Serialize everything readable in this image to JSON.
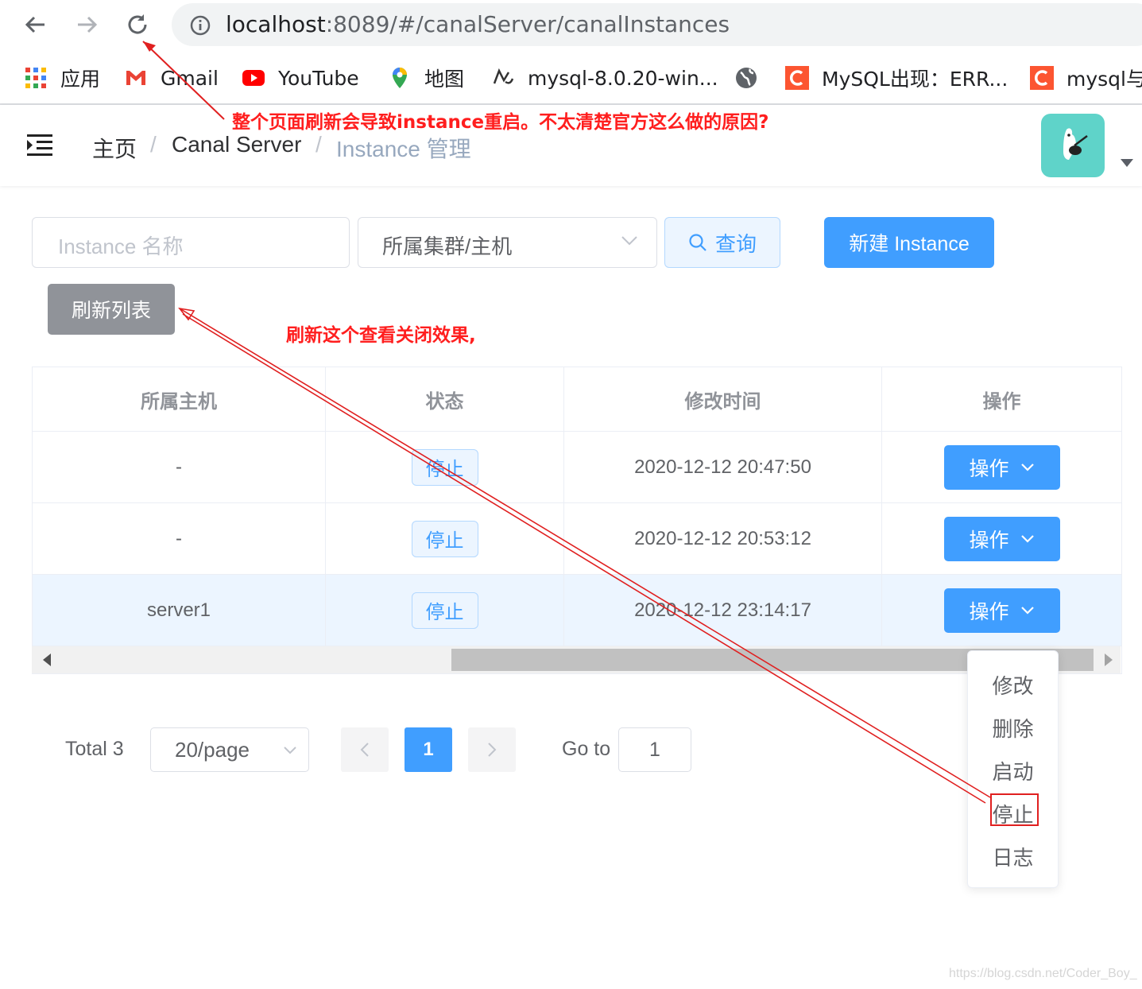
{
  "browser": {
    "url_host": "localhost",
    "url_rest": ":8089/#/canalServer/canalInstances",
    "bookmarks": [
      {
        "label": "应用",
        "icon": "apps-grid-icon"
      },
      {
        "label": "Gmail",
        "icon": "gmail-icon"
      },
      {
        "label": "YouTube",
        "icon": "youtube-icon"
      },
      {
        "label": "地图",
        "icon": "maps-pin-icon"
      },
      {
        "label": "mysql-8.0.20-win...",
        "icon": "bookmark-site-icon"
      },
      {
        "label": "",
        "icon": "globe-icon"
      },
      {
        "label": "MySQL出现：ERR...",
        "icon": "csdn-c-icon"
      },
      {
        "label": "mysql与",
        "icon": "csdn-c-icon"
      }
    ]
  },
  "breadcrumb": {
    "home": "主页",
    "sep1": "/",
    "section": "Canal Server",
    "sep2": "/",
    "current": "Instance 管理"
  },
  "filters": {
    "name_placeholder": "Instance 名称",
    "cluster_select": "所属集群/主机",
    "query_label": "查询",
    "new_label": "新建 Instance",
    "refresh_label": "刷新列表"
  },
  "annotations": {
    "top_note": "整个页面刷新会导致instance重启。不太清楚官方这么做的原因?",
    "refresh_note": "刷新这个查看关闭效果,"
  },
  "table": {
    "columns": [
      "所属主机",
      "状态",
      "修改时间",
      "操作"
    ],
    "rows": [
      {
        "host": "-",
        "status": "停止",
        "modified": "2020-12-12 20:47:50",
        "action": "操作"
      },
      {
        "host": "-",
        "status": "停止",
        "modified": "2020-12-12 20:53:12",
        "action": "操作"
      },
      {
        "host": "server1",
        "status": "停止",
        "modified": "2020-12-12 23:14:17",
        "action": "操作"
      }
    ]
  },
  "menu": {
    "items": [
      "修改",
      "删除",
      "启动",
      "停止",
      "日志"
    ]
  },
  "pagination": {
    "total": "Total 3",
    "page_size": "20/page",
    "current_page": "1",
    "goto_label": "Go to",
    "goto_value": "1"
  },
  "watermark": "https://blog.csdn.net/Coder_Boy_",
  "colors": {
    "primary": "#409eff",
    "annotation_red": "#ff1e1e",
    "info_gray": "#909399"
  }
}
